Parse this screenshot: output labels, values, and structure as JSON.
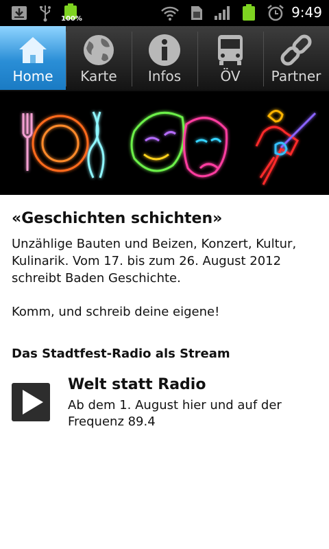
{
  "statusbar": {
    "time": "9:49",
    "battery_label": "100%",
    "icons": [
      "download-icon",
      "usb-icon",
      "battery-full-icon",
      "wifi-icon",
      "sim-icon",
      "signal-icon",
      "battery-icon",
      "alarm-icon"
    ]
  },
  "tabs": [
    {
      "label": "Home",
      "icon": "home-icon",
      "active": true
    },
    {
      "label": "Karte",
      "icon": "globe-icon",
      "active": false
    },
    {
      "label": "Infos",
      "icon": "info-icon",
      "active": false
    },
    {
      "label": "ÖV",
      "icon": "bus-icon",
      "active": false
    },
    {
      "label": "Partner",
      "icon": "link-icon",
      "active": false
    }
  ],
  "banner": {
    "images": [
      "neon-plate-cutlery",
      "neon-theatre-masks",
      "neon-guitar-player"
    ]
  },
  "main": {
    "headline": "«Geschichten schichten»",
    "paragraph1": "Unzählige Bauten und Beizen, Konzert, Kultur, Kulinarik. Vom 17. bis zum 26. August 2012 schreibt Baden Geschichte.",
    "paragraph2": "Komm, und schreib deine eigene!",
    "stream_title": "Das Stadtfest-Radio als Stream"
  },
  "player": {
    "title": "Welt statt Radio",
    "subtitle": "Ab dem 1. August hier und auf der Frequenz 89.4",
    "button_icon": "play-icon"
  },
  "colors": {
    "active_tab": "#2a8ed6",
    "tabbar": "#1e1e1e",
    "statusbar": "#000000",
    "battery_green": "#7ed321"
  }
}
